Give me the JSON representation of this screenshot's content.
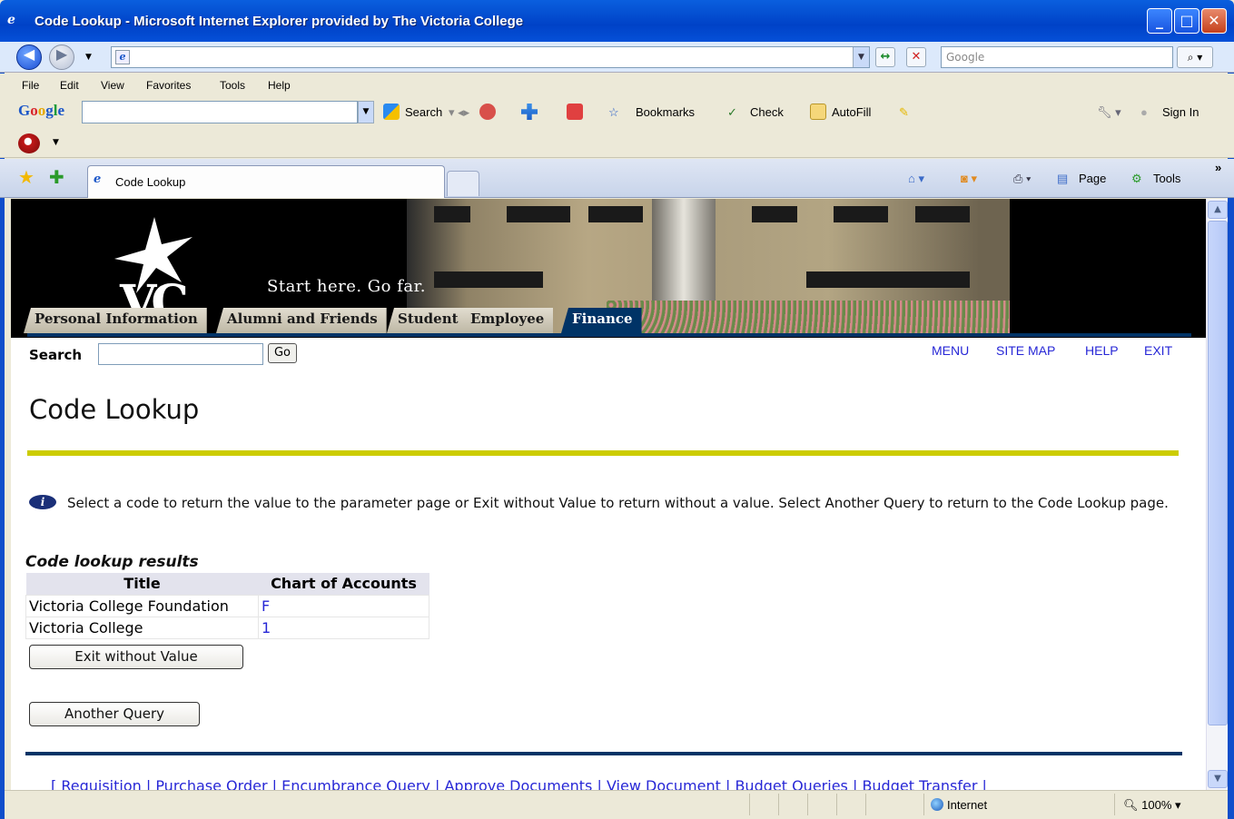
{
  "window": {
    "title": "Code Lookup - Microsoft Internet Explorer provided by The Victoria College",
    "controls": [
      "_",
      "□",
      "✕"
    ]
  },
  "address_bar": {
    "url": "",
    "search_placeholder": "Google"
  },
  "menu": [
    "File",
    "Edit",
    "View",
    "Favorites",
    "Tools",
    "Help"
  ],
  "google_toolbar": {
    "logo_letters": [
      "G",
      "o",
      "o",
      "g",
      "l",
      "e"
    ],
    "search_label": "Search",
    "bookmarks_label": "Bookmarks",
    "check_label": "Check",
    "autofill_label": "AutoFill",
    "signin_label": "Sign In"
  },
  "tab": {
    "label": "Code Lookup"
  },
  "command_bar": {
    "page_label": "Page",
    "tools_label": "Tools"
  },
  "banner": {
    "tagline": "Start here.  Go far.",
    "logo_text": "VC",
    "nav_tabs": [
      "Personal Information",
      "Alumni and Friends",
      "Student",
      "Employee",
      "Finance"
    ],
    "active_tab": "Finance"
  },
  "search": {
    "label": "Search",
    "value": "",
    "go_label": "Go"
  },
  "top_links": [
    "MENU",
    "SITE MAP",
    "HELP",
    "EXIT"
  ],
  "page": {
    "title": "Code Lookup",
    "info": "Select a code to return the value to the parameter page or Exit without Value to return without a value. Select Another Query to return to the Code Lookup page.",
    "results_caption": "Code lookup results",
    "columns": [
      "Title",
      "Chart of Accounts"
    ],
    "rows": [
      {
        "title": "Victoria College Foundation",
        "code": "F"
      },
      {
        "title": "Victoria College",
        "code": "1"
      }
    ],
    "exit_button": "Exit without Value",
    "query_button": "Another Query",
    "footer_links": [
      "Requisition",
      "Purchase Order",
      "Encumbrance Query",
      "Approve Documents",
      "View Document",
      "Budget Queries",
      "Budget Transfer"
    ]
  },
  "status_bar": {
    "zone": "Internet",
    "zoom": "100%"
  },
  "colors": {
    "link": "#2727d6",
    "title_rule": "#cccc00",
    "navy": "#003366"
  }
}
